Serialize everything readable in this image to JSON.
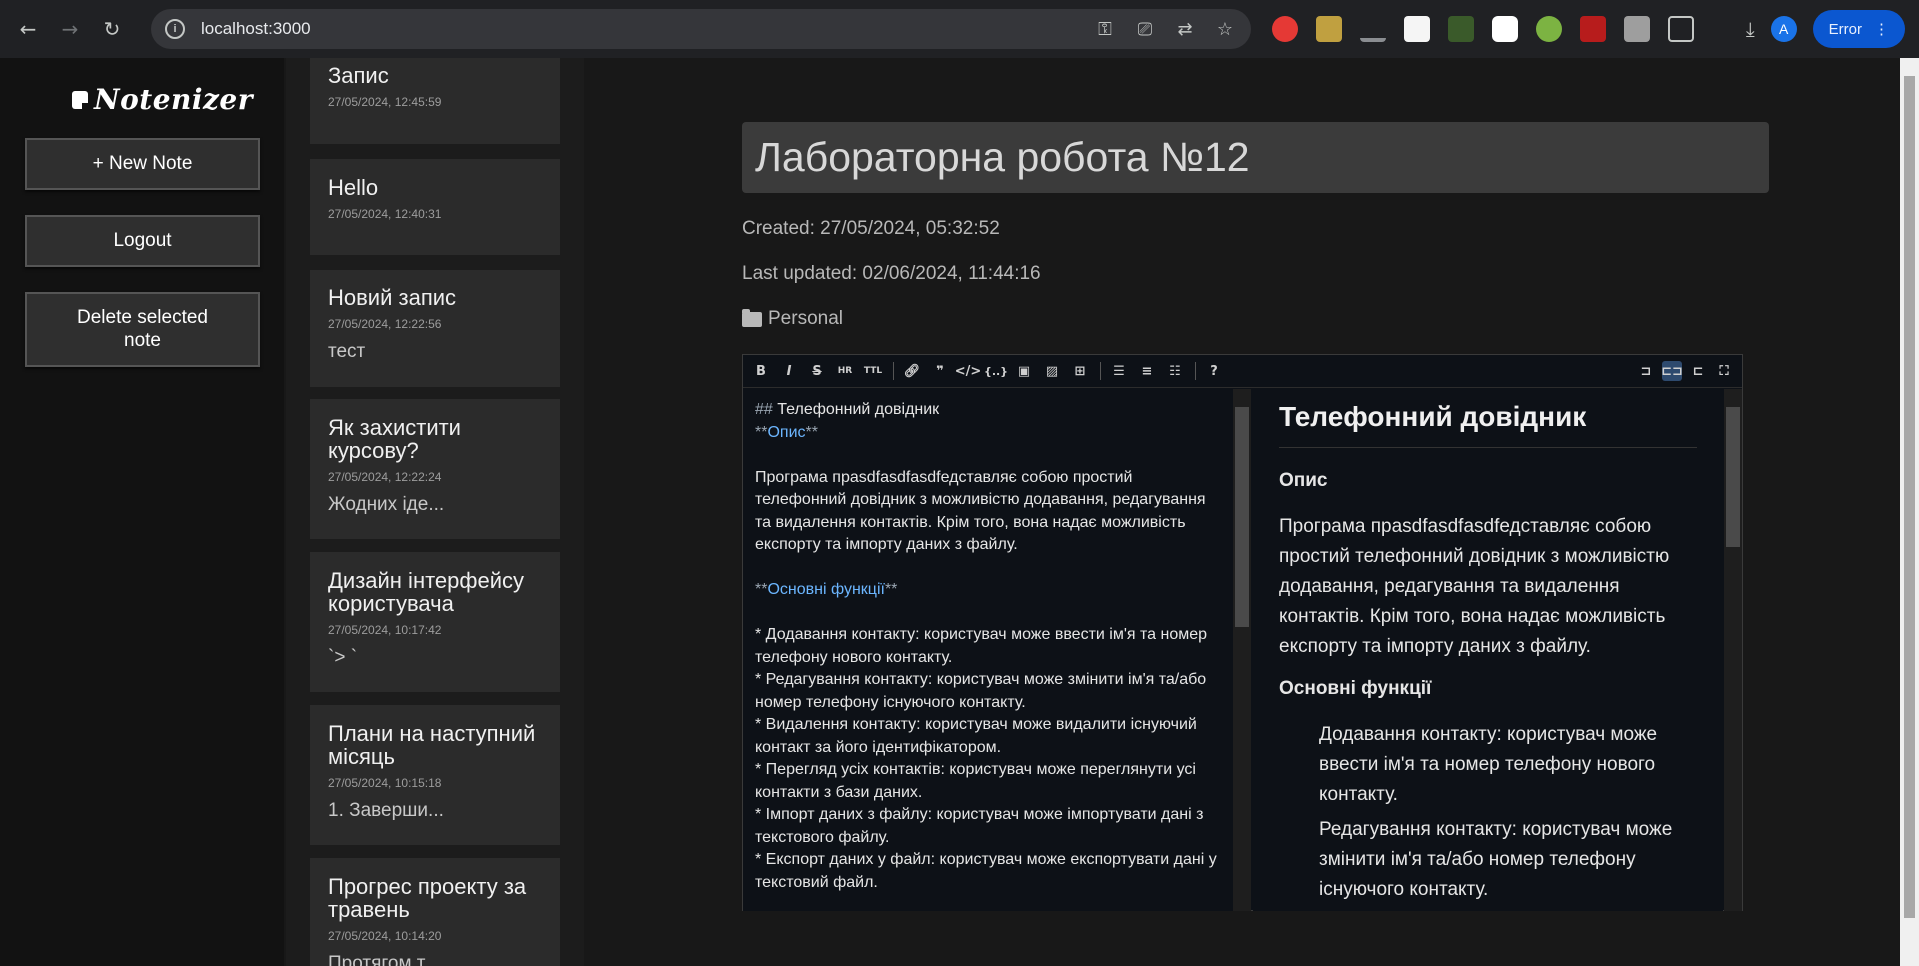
{
  "browser": {
    "url": "localhost:3000",
    "profile_initial": "A",
    "error_label": "Error"
  },
  "sidebar": {
    "logo": "Notenizer",
    "new_note": "+ New Note",
    "logout": "Logout",
    "delete_note": "Delete selected note"
  },
  "notes": [
    {
      "title": "Запис",
      "date": "27/05/2024, 12:45:59",
      "preview": ""
    },
    {
      "title": "Hello",
      "date": "27/05/2024, 12:40:31",
      "preview": ""
    },
    {
      "title": "Новий запис",
      "date": "27/05/2024, 12:22:56",
      "preview": "тест"
    },
    {
      "title": "Як захистити курсову?",
      "date": "27/05/2024, 12:22:24",
      "preview": "Жодних іде..."
    },
    {
      "title": "Дизайн інтерфейсу користувача",
      "date": "27/05/2024, 10:17:42",
      "preview": "`> `"
    },
    {
      "title": "Плани на наступний місяць",
      "date": "27/05/2024, 10:15:18",
      "preview": "1. Заверши..."
    },
    {
      "title": "Прогрес проекту за травень",
      "date": "27/05/2024, 10:14:20",
      "preview": "Протягом т..."
    }
  ],
  "note": {
    "title": "Лабораторна робота №12",
    "created": "Created: 27/05/2024, 05:32:52",
    "updated": "Last updated: 02/06/2024, 11:44:16",
    "folder": "Personal"
  },
  "editor": {
    "src_heading_mark": "## ",
    "src_heading": "Телефонний довідник",
    "src_bold_mark": "**",
    "src_opys": "Опис",
    "src_para1": "Програма прasdfasdfasdfедставляє собою простий телефонний довідник з можливістю додавання, редагування та видалення контактів. Крім того, вона надає можливість експорту та імпорту даних з файлу.",
    "src_func": "Основні функції",
    "src_items": [
      "* Додавання контакту: користувач може ввести ім'я та номер телефону нового контакту.",
      "* Редагування контакту: користувач може змінити ім'я та/або номер телефону існуючого контакту.",
      "* Видалення контакту: користувач може видалити існуючий контакт за його ідентифікатором.",
      "* Перегляд усіх контактів: користувач може переглянути усі контакти з бази даних.",
      "* Імпорт даних з файлу: користувач може імпортувати дані з текстового файлу.",
      "* Експорт даних у файл: користувач може експортувати дані у текстовий файл."
    ],
    "prev_heading": "Телефонний довідник",
    "prev_opys": "Опис",
    "prev_para1": "Програма прasdfasdfasdfедставляє собою простий телефонний довідник з можливістю додавання, редагування та видалення контактів. Крім того, вона надає можливість експорту та імпорту даних з файлу.",
    "prev_func": "Основні функції",
    "prev_items": [
      "Додавання контакту: користувач може ввести ім'я та номер телефону нового контакту.",
      "Редагування контакту: користувач може змінити ім'я та/або номер телефону існуючого контакту."
    ]
  },
  "colors": {
    "accent_link": "#6cb6ff",
    "error_pill": "#0b57d0"
  }
}
